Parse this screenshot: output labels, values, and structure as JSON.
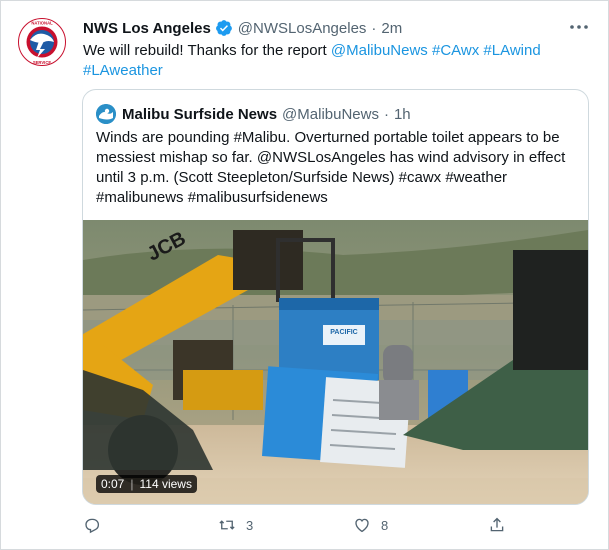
{
  "tweet": {
    "author_name": "NWS Los Angeles",
    "author_handle": "@NWSLosAngeles",
    "separator": "·",
    "time": "2m",
    "avatar_lettering": "NATIONAL WEATHER SERVICE",
    "text_plain": "We will rebuild! Thanks for the report ",
    "mentions": [
      "@MalibuNews",
      "#CAwx",
      "#LAwind",
      "#LAweather"
    ]
  },
  "quote": {
    "author_name": "Malibu Surfside News",
    "author_handle": "@MalibuNews",
    "separator": "·",
    "time": "1h",
    "text": "Winds are pounding #Malibu. Overturned portable toilet appears to be messiest mishap so far. @NWSLosAngeles has wind advisory in effect until 3 p.m. (Scott Steepleton/Surfside News) #cawx #weather #malibunews #malibusurfsidenews",
    "video": {
      "timestamp": "0:07",
      "views": "114 views",
      "scene_text": {
        "brand": "JCB",
        "toilet_brand": "PACIFIC"
      }
    }
  },
  "actions": {
    "reply_count": "",
    "retweet_count": "3",
    "like_count": "8"
  },
  "colors": {
    "link": "#1b95e0",
    "verified": "#1d9bf0",
    "muted": "#536471"
  },
  "icons": [
    "more-icon",
    "verified-icon",
    "reply-icon",
    "retweet-icon",
    "like-icon",
    "share-icon"
  ]
}
